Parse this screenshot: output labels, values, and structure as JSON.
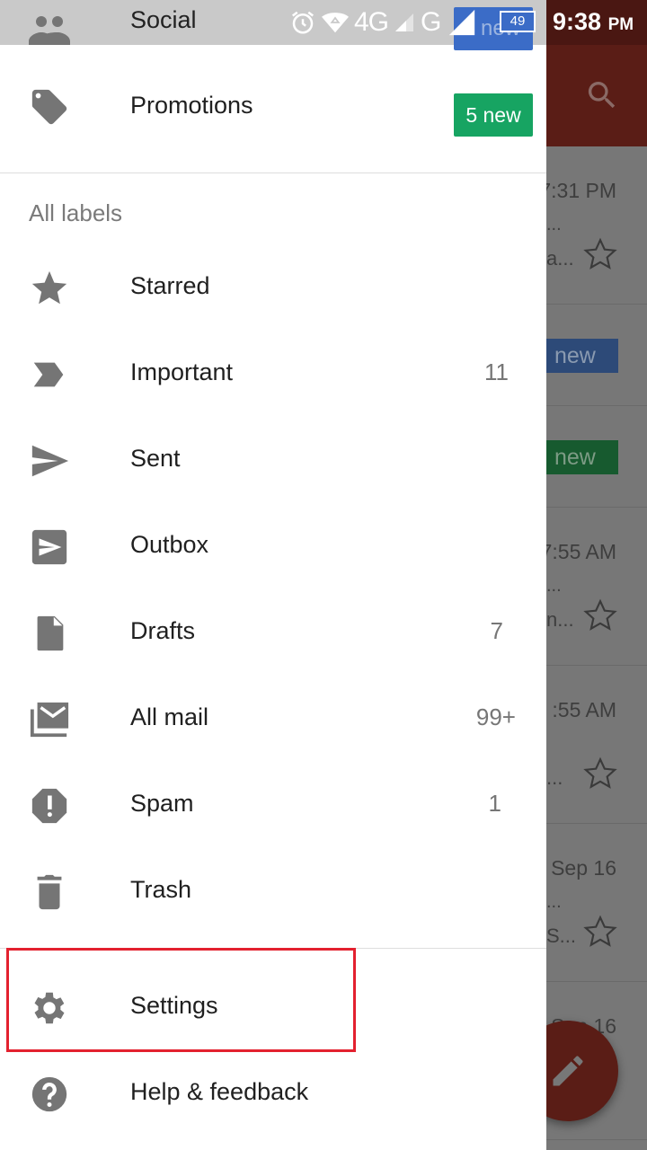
{
  "status_bar": {
    "time": "9:38",
    "ampm": "PM",
    "network_label": "4G",
    "network_label_2": "G",
    "battery": "49",
    "icons": [
      "alarm-icon",
      "wifi-icon",
      "signal-icon",
      "signal-icon-2",
      "battery-icon"
    ]
  },
  "background_inbox": {
    "appbar_color": "#5a1d16",
    "search_icon": "search-icon",
    "rows": [
      {
        "time": "7:31 PM",
        "snippet": "a...",
        "dots": "..."
      },
      {
        "badge": "new",
        "badge_color": "#2d4a78"
      },
      {
        "badge": "new",
        "badge_color": "#175a2f"
      },
      {
        "time": "7:55 AM",
        "snippet": "n...",
        "dots": "..."
      },
      {
        "time": ":55 AM",
        "snippet": "...",
        "dots": ""
      },
      {
        "time": "Sep 16",
        "snippet": "S...",
        "dots": "..."
      },
      {
        "time": "Sep 16",
        "snippet": "",
        "dots": ""
      }
    ],
    "fab_icon": "pencil-icon"
  },
  "drawer": {
    "categories": [
      {
        "label": "Social",
        "icon": "people-icon",
        "badge": "new",
        "badge_color": "#3b6cc7"
      },
      {
        "label": "Promotions",
        "icon": "tag-icon",
        "badge": "5 new",
        "badge_color": "#17a462"
      }
    ],
    "section_label": "All labels",
    "labels": [
      {
        "label": "Starred",
        "icon": "star-icon",
        "count": ""
      },
      {
        "label": "Important",
        "icon": "important-icon",
        "count": "11"
      },
      {
        "label": "Sent",
        "icon": "send-icon",
        "count": ""
      },
      {
        "label": "Outbox",
        "icon": "outbox-icon",
        "count": ""
      },
      {
        "label": "Drafts",
        "icon": "draft-icon",
        "count": "7"
      },
      {
        "label": "All mail",
        "icon": "all-mail-icon",
        "count": "99+"
      },
      {
        "label": "Spam",
        "icon": "spam-icon",
        "count": "1"
      },
      {
        "label": "Trash",
        "icon": "trash-icon",
        "count": ""
      }
    ],
    "footer": [
      {
        "label": "Settings",
        "icon": "gear-icon",
        "highlighted": true
      },
      {
        "label": "Help & feedback",
        "icon": "help-icon"
      }
    ]
  },
  "colors": {
    "icon_gray": "#757575",
    "highlight_red": "#e3212f",
    "promo_green": "#17a462"
  }
}
